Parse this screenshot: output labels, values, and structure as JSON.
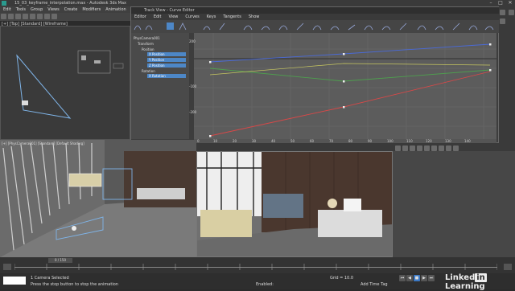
{
  "app": {
    "title": "15_03_keyframe_interpolation.max - Autodesk 3ds Max",
    "workspace_menu": [
      "Edit",
      "Tools",
      "Group",
      "Views",
      "Create",
      "Modifiers",
      "Animation"
    ]
  },
  "left_viewport": {
    "label": "[+] [Top] [Standard] [Wireframe]"
  },
  "curve_editor": {
    "title": "Track View - Curve Editor",
    "menu": [
      "Editor",
      "Edit",
      "View",
      "Curves",
      "Keys",
      "Tangents",
      "Show"
    ],
    "tree": [
      {
        "label": "PhysCamera001",
        "selected": false
      },
      {
        "label": "Transform",
        "selected": false
      },
      {
        "label": "Position",
        "selected": false
      },
      {
        "label": "X Position",
        "selected": true
      },
      {
        "label": "Y Position",
        "selected": true
      },
      {
        "label": "Z Position",
        "selected": true
      },
      {
        "label": "Rotation",
        "selected": false
      },
      {
        "label": "X Rotation",
        "selected": true
      }
    ],
    "y_ticks": [
      "200",
      "-100",
      "-200"
    ],
    "x_ticks": [
      "0",
      "10",
      "20",
      "30",
      "40",
      "50",
      "60",
      "70",
      "80",
      "90",
      "100",
      "110",
      "120",
      "130",
      "140"
    ]
  },
  "viewports": {
    "perspective_label": "[+] [PhysCamera001] [Standard] [Default Shading]",
    "camera_label": ""
  },
  "timeline": {
    "frame_counter": "0 / 150"
  },
  "status": {
    "selection": "1 Camera Selected",
    "hint": "Click or click-and-drag to select objects",
    "prompt": "Press the stop button to stop the animation",
    "enabled_label": "Enabled:",
    "add_time_tag": "Add Time Tag",
    "x_label": "X:",
    "grid_label": "Grid = 10.0",
    "auto": "Auto",
    "set_key": "Set K",
    "selected": "Selected",
    "filters": "Key Filters..."
  },
  "branding": {
    "name": "Linked",
    "mark": "in",
    "suffix": " Learning"
  }
}
